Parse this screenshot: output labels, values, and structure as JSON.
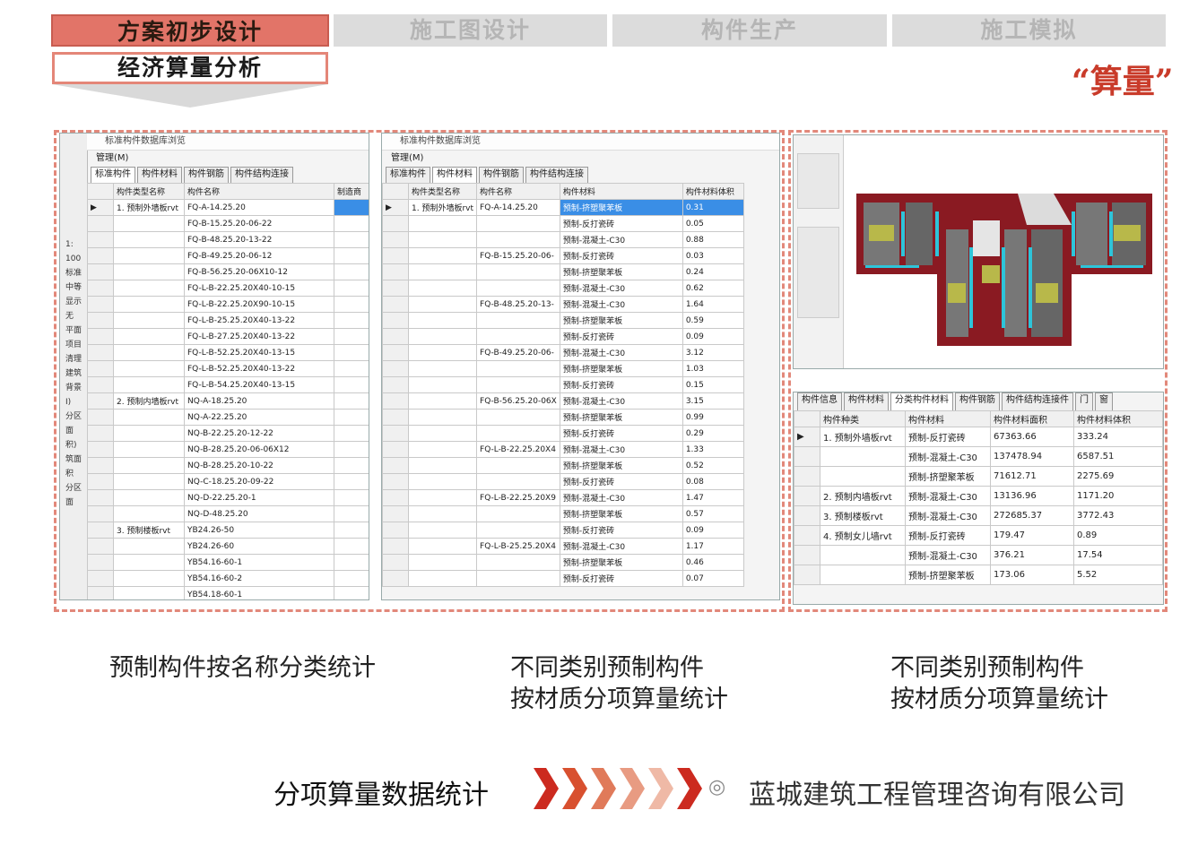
{
  "tabs": [
    {
      "label": "方案初步设计",
      "active": true
    },
    {
      "label": "施工图设计",
      "active": false
    },
    {
      "label": "构件生产",
      "active": false
    },
    {
      "label": "施工模拟",
      "active": false
    }
  ],
  "subtab": "经济算量分析",
  "quote_label": "“算量”",
  "panel1": {
    "title": "标准构件数据库浏览",
    "menu": "管理(M)",
    "tabs": [
      "标准构件",
      "构件材料",
      "构件钢筋",
      "构件结构连接"
    ],
    "headers": [
      "构件类型名称",
      "构件名称",
      "制造商"
    ],
    "groups": [
      {
        "type": "1. 预制外墙板rvt",
        "items": [
          "FQ-A-14.25.20",
          "FQ-B-15.25.20-06-22",
          "FQ-B-48.25.20-13-22",
          "FQ-B-49.25.20-06-12",
          "FQ-B-56.25.20-06X10-12",
          "FQ-L-B-22.25.20X40-10-15",
          "FQ-L-B-22.25.20X90-10-15",
          "FQ-L-B-25.25.20X40-13-22",
          "FQ-L-B-27.25.20X40-13-22",
          "FQ-L-B-52.25.20X40-13-15",
          "FQ-L-B-52.25.20X40-13-22",
          "FQ-L-B-54.25.20X40-13-15"
        ]
      },
      {
        "type": "2. 预制内墙板rvt",
        "items": [
          "NQ-A-18.25.20",
          "NQ-A-22.25.20",
          "NQ-B-22.25.20-12-22",
          "NQ-B-28.25.20-06-06X12",
          "NQ-B-28.25.20-10-22",
          "NQ-C-18.25.20-09-22",
          "NQ-D-22.25.20-1",
          "NQ-D-48.25.20"
        ]
      },
      {
        "type": "3. 预制楼板rvt",
        "items": [
          "YB24.26-50",
          "YB24.26-60",
          "YB54.16-60-1",
          "YB54.16-60-2",
          "YB54.18-60-1"
        ]
      }
    ],
    "side_labels": [
      "1:",
      "100",
      "标准",
      "中等",
      "显示",
      "无",
      "平面",
      "项目",
      "清理",
      "建筑",
      "背景",
      "I)",
      "分区面",
      "积)",
      "筑面积",
      "分区面"
    ]
  },
  "panel2": {
    "title": "标准构件数据库浏览",
    "menu": "管理(M)",
    "tabs": [
      "标准构件",
      "构件材料",
      "构件钢筋",
      "构件结构连接"
    ],
    "headers": [
      "构件类型名称",
      "构件名称",
      "构件材料",
      "构件材料体积"
    ],
    "type": "1. 预制外墙板rvt",
    "rows": [
      {
        "name": "FQ-A-14.25.20",
        "mat": "预制-挤塑聚苯板",
        "vol": "0.31",
        "sel": true
      },
      {
        "name": "",
        "mat": "预制-反打瓷砖",
        "vol": "0.05"
      },
      {
        "name": "",
        "mat": "预制-混凝土-C30",
        "vol": "0.88"
      },
      {
        "name": "FQ-B-15.25.20-06-",
        "mat": "预制-反打瓷砖",
        "vol": "0.03"
      },
      {
        "name": "",
        "mat": "预制-挤塑聚苯板",
        "vol": "0.24"
      },
      {
        "name": "",
        "mat": "预制-混凝土-C30",
        "vol": "0.62"
      },
      {
        "name": "FQ-B-48.25.20-13-",
        "mat": "预制-混凝土-C30",
        "vol": "1.64"
      },
      {
        "name": "",
        "mat": "预制-挤塑聚苯板",
        "vol": "0.59"
      },
      {
        "name": "",
        "mat": "预制-反打瓷砖",
        "vol": "0.09"
      },
      {
        "name": "FQ-B-49.25.20-06-",
        "mat": "预制-混凝土-C30",
        "vol": "3.12"
      },
      {
        "name": "",
        "mat": "预制-挤塑聚苯板",
        "vol": "1.03"
      },
      {
        "name": "",
        "mat": "预制-反打瓷砖",
        "vol": "0.15"
      },
      {
        "name": "FQ-B-56.25.20-06X",
        "mat": "预制-混凝土-C30",
        "vol": "3.15"
      },
      {
        "name": "",
        "mat": "预制-挤塑聚苯板",
        "vol": "0.99"
      },
      {
        "name": "",
        "mat": "预制-反打瓷砖",
        "vol": "0.29"
      },
      {
        "name": "FQ-L-B-22.25.20X4",
        "mat": "预制-混凝土-C30",
        "vol": "1.33"
      },
      {
        "name": "",
        "mat": "预制-挤塑聚苯板",
        "vol": "0.52"
      },
      {
        "name": "",
        "mat": "预制-反打瓷砖",
        "vol": "0.08"
      },
      {
        "name": "FQ-L-B-22.25.20X9",
        "mat": "预制-混凝土-C30",
        "vol": "1.47"
      },
      {
        "name": "",
        "mat": "预制-挤塑聚苯板",
        "vol": "0.57"
      },
      {
        "name": "",
        "mat": "预制-反打瓷砖",
        "vol": "0.09"
      },
      {
        "name": "FQ-L-B-25.25.20X4",
        "mat": "预制-混凝土-C30",
        "vol": "1.17"
      },
      {
        "name": "",
        "mat": "预制-挤塑聚苯板",
        "vol": "0.46"
      },
      {
        "name": "",
        "mat": "预制-反打瓷砖",
        "vol": "0.07"
      }
    ]
  },
  "panel3": {
    "tabs": [
      "构件信息",
      "构件材料",
      "分类构件材料",
      "构件钢筋",
      "构件结构连接件",
      "门",
      "窗"
    ],
    "headers": [
      "构件种类",
      "构件材料",
      "构件材料面积",
      "构件材料体积"
    ],
    "rows": [
      {
        "kind": "1. 预制外墙板rvt",
        "mat": "预制-反打瓷砖",
        "area": "67363.66",
        "vol": "333.24"
      },
      {
        "kind": "",
        "mat": "预制-混凝土-C30",
        "area": "137478.94",
        "vol": "6587.51"
      },
      {
        "kind": "",
        "mat": "预制-挤塑聚苯板",
        "area": "71612.71",
        "vol": "2275.69"
      },
      {
        "kind": "2. 预制内墙板rvt",
        "mat": "预制-混凝土-C30",
        "area": "13136.96",
        "vol": "1171.20"
      },
      {
        "kind": "3. 预制楼板rvt",
        "mat": "预制-混凝土-C30",
        "area": "272685.37",
        "vol": "3772.43"
      },
      {
        "kind": "4. 预制女儿墙rvt",
        "mat": "预制-反打瓷砖",
        "area": "179.47",
        "vol": "0.89"
      },
      {
        "kind": "",
        "mat": "预制-混凝土-C30",
        "area": "376.21",
        "vol": "17.54"
      },
      {
        "kind": "",
        "mat": "预制-挤塑聚苯板",
        "area": "173.06",
        "vol": "5.52"
      }
    ]
  },
  "captions": {
    "c1": "预制构件按名称分类统计",
    "c2_line1": "不同类别预制构件",
    "c2_line2": "按材质分项算量统计",
    "c3_line1": "不同类别预制构件",
    "c3_line2": "按材质分项算量统计"
  },
  "bottom": {
    "label": "分项算量数据统计",
    "company": "蓝城建筑工程管理咨询有限公司"
  },
  "colors": {
    "active_tab": "#e27468",
    "dash": "#e2887a",
    "accent_red": "#c93b2a",
    "selection": "#3a8ee6"
  }
}
